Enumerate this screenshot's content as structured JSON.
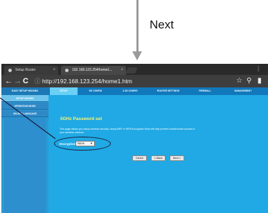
{
  "annotation": {
    "next_label": "Next"
  },
  "browser": {
    "tabs": [
      {
        "title": "Setup Router",
        "active": false
      },
      {
        "title": "192.168.123.254/home1...",
        "active": true
      }
    ],
    "close_glyph": "×",
    "nav": {
      "back": "←",
      "forward": "→",
      "reload": "C",
      "secure_icon": "ⓘ"
    },
    "url": "http://192.168.123.254/home1.htm",
    "right_icons": [
      "star-icon",
      "search-icon",
      "bookmark-icon"
    ]
  },
  "router_ui": {
    "sidebar": {
      "header": "EASY SETUP WIZARD",
      "items": [
        {
          "label": "SETUP WIZARD",
          "active": true
        },
        {
          "label": "OPERATION MODE",
          "active": false
        },
        {
          "label": "SELECT LANGUAGE",
          "active": false
        }
      ]
    },
    "topnav": [
      {
        "label": "SETUP",
        "active": true
      },
      {
        "label": "5G CONFIG",
        "active": false
      },
      {
        "label": "2.4G CONFIG",
        "active": false
      },
      {
        "label": "ROUTER SETTINGS",
        "active": false
      },
      {
        "label": "FIREWALL",
        "active": false
      },
      {
        "label": "MANAGEMENT",
        "active": false
      }
    ],
    "content": {
      "title": "5GHz Password set",
      "description": "This page allows you setup wireless security. Using WEP or WPA Encryption Keys will help prevent unauthorized access to your wireless network.",
      "encryption_label": "Encryption:",
      "encryption_value": "None",
      "buttons": {
        "cancel": "Cancel",
        "back": "<<Back",
        "next": "Next>>"
      }
    }
  },
  "colors": {
    "page_bg": "#20a9e4",
    "title_yellow": "#f6f57a",
    "topnav_active": "#6bd0f6"
  }
}
